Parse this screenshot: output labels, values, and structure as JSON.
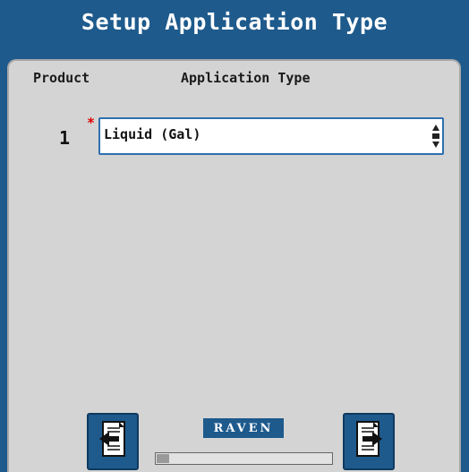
{
  "header": {
    "title": "Setup Application Type"
  },
  "columns": {
    "product": "Product",
    "application_type": "Application Type"
  },
  "rows": [
    {
      "number": "1",
      "required_marker": "*",
      "value": "Liquid (Gal)"
    }
  ],
  "footer": {
    "logo_text": "RAVEN",
    "progress_fraction": 0.07,
    "prev_icon": "page-back-icon",
    "next_icon": "page-forward-icon"
  },
  "colors": {
    "accent": "#1e5a8c",
    "panel": "#d4d4d4",
    "required": "#e00000"
  }
}
